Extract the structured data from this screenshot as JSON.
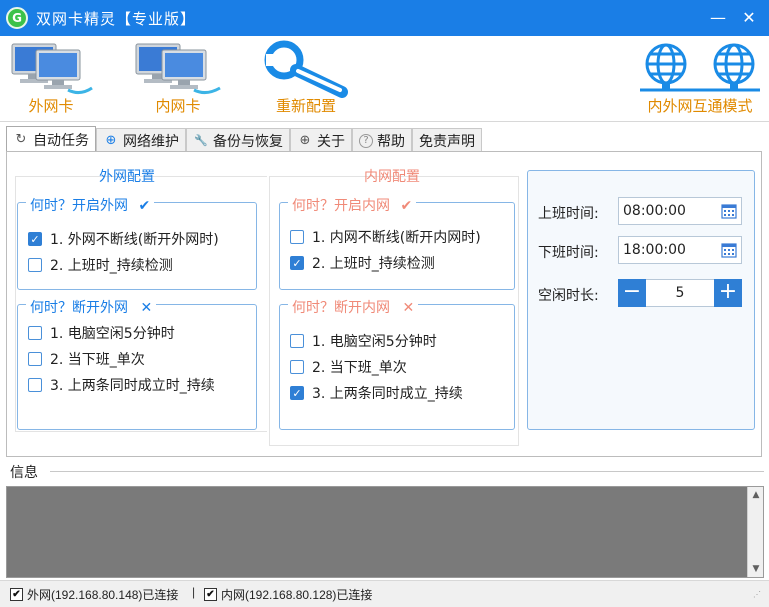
{
  "titlebar": {
    "title": "双网卡精灵【专业版】",
    "app_icon_letter": "G",
    "min_symbol": "—",
    "close_symbol": "✕"
  },
  "toolbar": {
    "external_nic": "外网卡",
    "internal_nic": "内网卡",
    "reset_config": "重新配置",
    "interconnect_mode": "内外网互通模式",
    "label_color": "#e08a00",
    "icon_color": "#1a8be6"
  },
  "tabs": [
    {
      "label": "自动任务",
      "icon": "refresh-icon",
      "glyph": "↻"
    },
    {
      "label": "网络维护",
      "icon": "globe-icon",
      "glyph": "⊕"
    },
    {
      "label": "备份与恢复",
      "icon": "wrench-icon",
      "glyph": "🔧"
    },
    {
      "label": "关于",
      "icon": "globe-icon",
      "glyph": "⊕"
    },
    {
      "label": "帮助",
      "icon": "help-icon",
      "glyph": "?"
    },
    {
      "label": "免责声明",
      "icon": "",
      "glyph": ""
    }
  ],
  "external": {
    "group_title": "外网配置",
    "on_title": "何时？开启外网",
    "on_mark": "✔",
    "on_options": [
      {
        "label": "1. 外网不断线(断开外网时)",
        "checked": true
      },
      {
        "label": "2. 上班时_持续检测",
        "checked": false
      }
    ],
    "off_title": "何时？断开外网",
    "off_mark": "✕",
    "off_options": [
      {
        "label": "1. 电脑空闲5分钟时",
        "checked": false
      },
      {
        "label": "2. 当下班_单次",
        "checked": false
      },
      {
        "label": "3. 上两条同时成立时_持续",
        "checked": false
      }
    ]
  },
  "internal": {
    "group_title": "内网配置",
    "on_title": "何时？开启内网",
    "on_mark": "✔",
    "on_options": [
      {
        "label": "1. 内网不断线(断开内网时)",
        "checked": false
      },
      {
        "label": "2. 上班时_持续检测",
        "checked": true
      }
    ],
    "off_title": "何时？断开内网",
    "off_mark": "✕",
    "off_options": [
      {
        "label": "1. 电脑空闲5分钟时",
        "checked": false
      },
      {
        "label": "2. 当下班_单次",
        "checked": false
      },
      {
        "label": "3. 上两条同时成立_持续",
        "checked": true
      }
    ]
  },
  "schedule": {
    "work_start_label": "上班时间:",
    "work_start_value": "08:00:00",
    "work_end_label": "下班时间:",
    "work_end_value": "18:00:00",
    "idle_label": "空闲时长:",
    "idle_value": "5",
    "minus": "−",
    "plus": "+"
  },
  "info": {
    "label": "信息"
  },
  "status": {
    "external": "外网(192.168.80.148)已连接",
    "separator": "|",
    "internal": "内网(192.168.80.128)已连接",
    "check": "✔"
  },
  "colors": {
    "titlebar": "#1a7ee6",
    "accent_blue": "#2f7fd5",
    "internal_accent": "#f08a78",
    "log_bg": "#7a7a7a"
  }
}
